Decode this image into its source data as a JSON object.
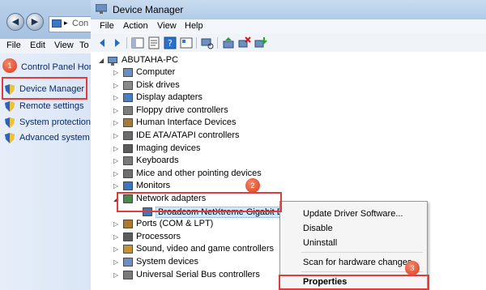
{
  "control_panel": {
    "address_text": "Con",
    "menu": [
      "File",
      "Edit",
      "View",
      "To"
    ],
    "home_link": "Control Panel Home",
    "links": [
      {
        "label": "Device Manager",
        "icon": "shield-icon"
      },
      {
        "label": "Remote settings",
        "icon": "shield-icon"
      },
      {
        "label": "System protection",
        "icon": "shield-icon"
      },
      {
        "label": "Advanced system se",
        "icon": "shield-icon"
      }
    ]
  },
  "device_manager": {
    "title": "Device Manager",
    "menu": [
      "File",
      "Action",
      "View",
      "Help"
    ],
    "root": "ABUTAHA-PC",
    "tree": [
      {
        "label": "Computer",
        "icon": "computer-icon",
        "expanded": false
      },
      {
        "label": "Disk drives",
        "icon": "disk-drive-icon",
        "expanded": false
      },
      {
        "label": "Display adapters",
        "icon": "display-adapter-icon",
        "expanded": false
      },
      {
        "label": "Floppy drive controllers",
        "icon": "floppy-controller-icon",
        "expanded": false
      },
      {
        "label": "Human Interface Devices",
        "icon": "hid-icon",
        "expanded": false
      },
      {
        "label": "IDE ATA/ATAPI controllers",
        "icon": "ide-controller-icon",
        "expanded": false
      },
      {
        "label": "Imaging devices",
        "icon": "camera-icon",
        "expanded": false
      },
      {
        "label": "Keyboards",
        "icon": "keyboard-icon",
        "expanded": false
      },
      {
        "label": "Mice and other pointing devices",
        "icon": "mouse-icon",
        "expanded": false
      },
      {
        "label": "Monitors",
        "icon": "monitor-icon",
        "expanded": false
      },
      {
        "label": "Network adapters",
        "icon": "network-adapter-icon",
        "expanded": true
      },
      {
        "label": "Broadcom NetXtreme Gigabit Etherne",
        "icon": "network-card-icon",
        "child": true,
        "selected": true
      },
      {
        "label": "Ports (COM & LPT)",
        "icon": "port-icon",
        "expanded": false
      },
      {
        "label": "Processors",
        "icon": "processor-icon",
        "expanded": false
      },
      {
        "label": "Sound, video and game controllers",
        "icon": "speaker-icon",
        "expanded": false
      },
      {
        "label": "System devices",
        "icon": "system-device-icon",
        "expanded": false
      },
      {
        "label": "Universal Serial Bus controllers",
        "icon": "usb-icon",
        "expanded": false
      }
    ]
  },
  "context_menu": {
    "items": [
      "Update Driver Software...",
      "Disable",
      "Uninstall",
      "Scan for hardware changes",
      "Properties"
    ]
  },
  "annotations": {
    "badges": [
      "1",
      "2",
      "3"
    ],
    "color": "#e03c3c"
  },
  "colors": {
    "title_bar": "#b9d1ea",
    "nav_pane": "#dfe8f5",
    "selection": "#cde8ff",
    "link": "#0b2a66"
  }
}
